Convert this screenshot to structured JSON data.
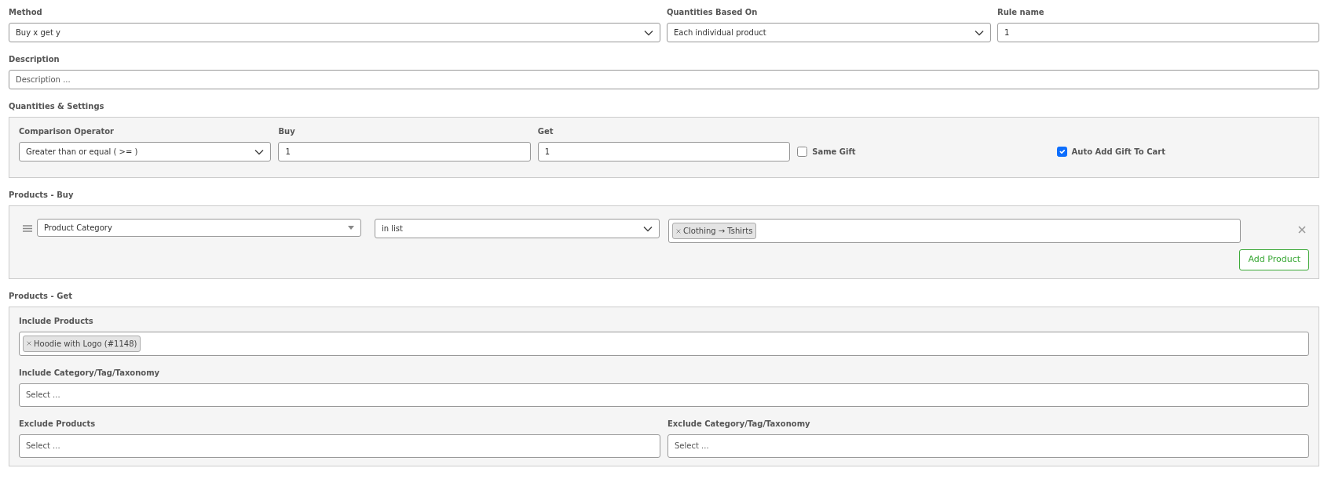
{
  "top_fields": [
    {
      "label": "Method",
      "kind": "select",
      "value": "Buy x get y"
    },
    {
      "label": "Quantities Based On",
      "kind": "select",
      "value": "Each individual product"
    },
    {
      "label": "Rule name",
      "kind": "text",
      "value": "1"
    }
  ],
  "description": {
    "label": "Description",
    "placeholder": "Description ..."
  },
  "quantities": {
    "title": "Quantities & Settings",
    "fields": [
      {
        "label": "Comparison Operator",
        "kind": "select",
        "value": "Greater than or equal ( >= )"
      },
      {
        "label": "Buy",
        "kind": "text",
        "value": "1"
      },
      {
        "label": "Get",
        "kind": "text",
        "value": "1"
      }
    ],
    "checkboxes": [
      {
        "label": "Same Gift",
        "checked": false
      },
      {
        "label": "Auto Add Gift To Cart",
        "checked": true
      }
    ]
  },
  "products_buy": {
    "title": "Products - Buy",
    "rows": [
      {
        "type": "Product Category",
        "operator": "in list",
        "tags": [
          "Clothing → Tshirts"
        ]
      }
    ],
    "add_button": "Add Product"
  },
  "products_get": {
    "title": "Products - Get",
    "fields": [
      {
        "label": "Include Products",
        "tags": [
          "Hoodie with Logo (#1148)"
        ]
      },
      {
        "label": "Include Category/Tag/Taxonomy",
        "placeholder": "Select ..."
      },
      {
        "label": "Exclude Products",
        "placeholder": "Select ..."
      },
      {
        "label": "Exclude Category/Tag/Taxonomy",
        "placeholder": "Select ..."
      }
    ]
  }
}
